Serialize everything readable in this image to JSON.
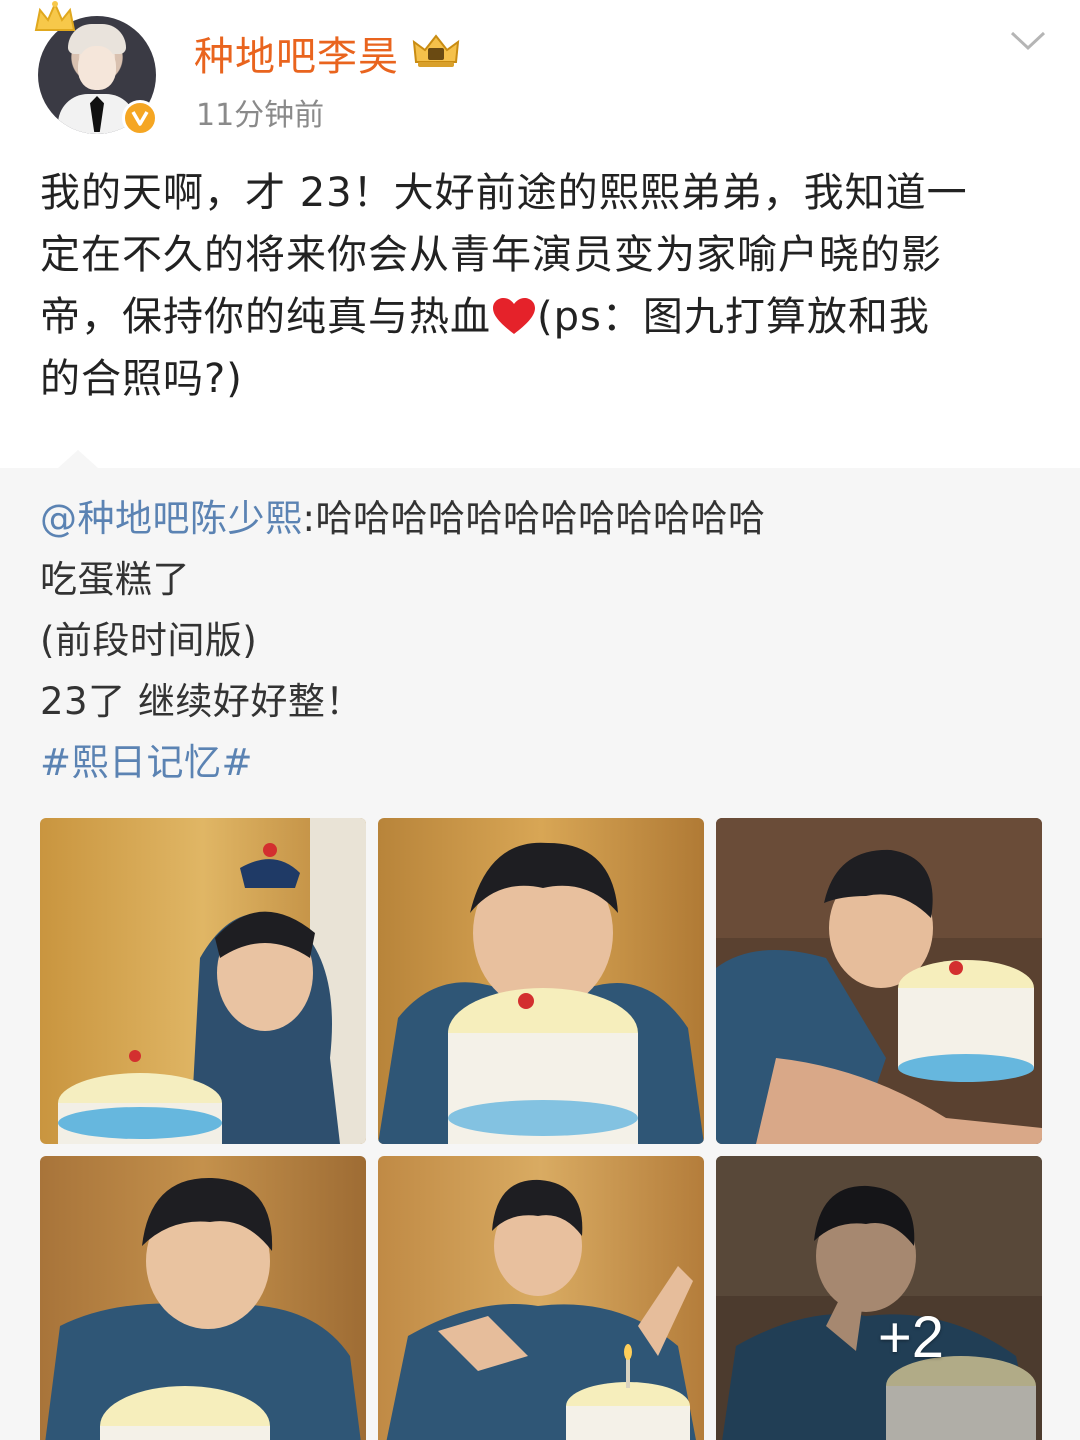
{
  "header": {
    "username": "种地吧李昊",
    "timestamp": "11分钟前"
  },
  "post": {
    "lines": [
      "我的天啊，才 23！大好前途的熙熙弟弟，我知道一",
      "定在不久的将来你会从青年演员变为家喻户晓的影",
      "帝，保持你的纯真与热血",
      "(ps：图九打算放和我",
      "的合照吗?)"
    ]
  },
  "repost": {
    "mention": "@种地吧陈少熙",
    "first_line_rest": ":哈哈哈哈哈哈哈哈哈哈哈哈",
    "line2": "吃蛋糕了",
    "line3": "(前段时间版)",
    "line4": "23了 继续好好整！",
    "hashtag": "#熙日记忆#"
  },
  "photos": {
    "more_count": "+2"
  },
  "colors": {
    "username": "#e9641e",
    "link": "#5b83b3",
    "repost_bg": "#f6f6f6",
    "verified": "#f5a623"
  }
}
